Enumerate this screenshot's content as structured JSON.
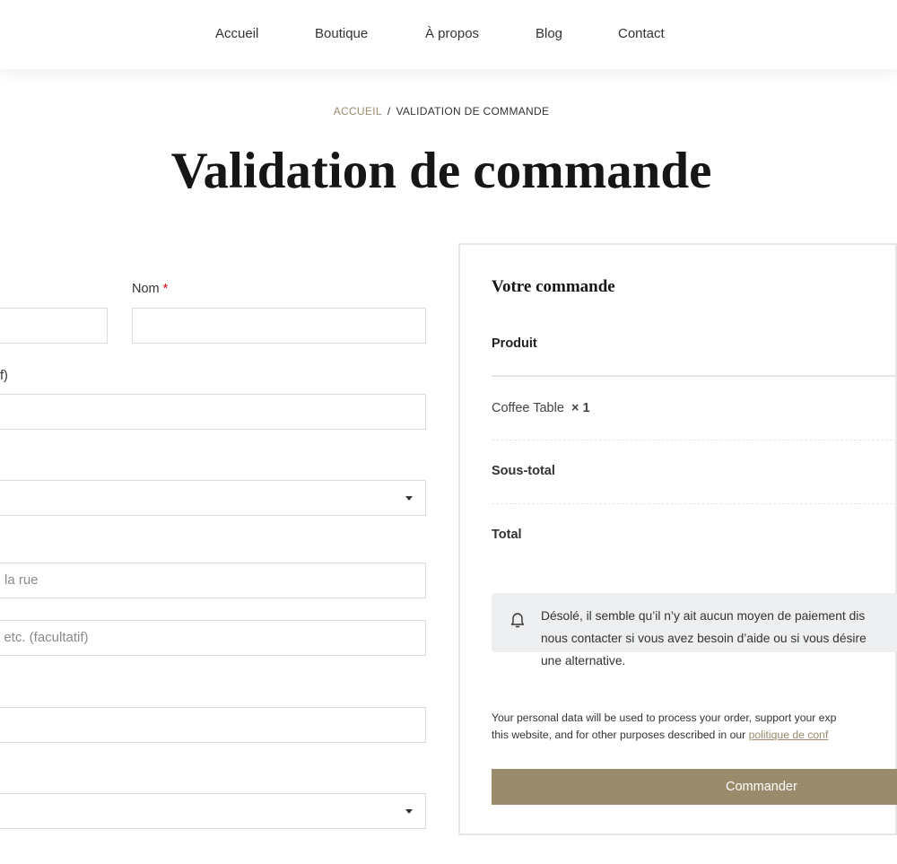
{
  "nav": {
    "items": [
      "Accueil",
      "Boutique",
      "À propos",
      "Blog",
      "Contact"
    ]
  },
  "breadcrumb": {
    "home": "ACCUEIL",
    "separator": "/",
    "current": "VALIDATION DE COMMANDE"
  },
  "page_title": "Validation de commande",
  "billing_form": {
    "last_name_label": "Nom",
    "required_mark": "*",
    "company_label_fragment": "f)",
    "street_placeholder_fragment": "la rue",
    "street2_placeholder_fragment": ", etc. (facultatif)"
  },
  "order": {
    "title": "Votre commande",
    "product_header": "Produit",
    "item_name": "Coffee Table",
    "item_qty": "× 1",
    "subtotal_label": "Sous-total",
    "total_label": "Total",
    "notice_lines": [
      "Désolé, il semble qu’il n’y ait aucun moyen de paiement dis",
      "nous contacter si vous avez besoin d’aide ou si vous désire",
      "une alternative."
    ],
    "notice_icon": "bell-icon",
    "privacy_line1": "Your personal data will be used to process your order, support your exp",
    "privacy_line2": "this website, and for other purposes described in our ",
    "privacy_link": "politique de conf",
    "order_button": "Commander"
  },
  "colors": {
    "accent": "#9b8b6d",
    "required": "#e2000f",
    "notice_bg": "#eeeff1"
  }
}
